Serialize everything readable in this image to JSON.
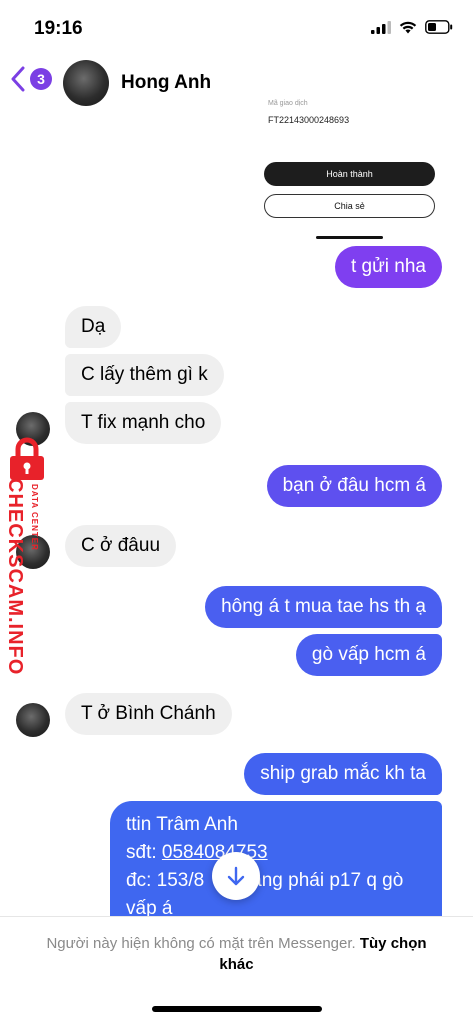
{
  "status": {
    "time": "19:16"
  },
  "header": {
    "back_count": "3",
    "contact_name": "Hong Anh"
  },
  "receipt": {
    "small_text": "Mã giao dịch",
    "code": "FT22143000248693",
    "primary_button": "Hoàn thành",
    "secondary_button": "Chia sẻ"
  },
  "messages": [
    {
      "side": "out",
      "text": "t gửi nha"
    },
    {
      "side": "in",
      "text": "Dạ"
    },
    {
      "side": "in",
      "text": "C lấy thêm gì k"
    },
    {
      "side": "in",
      "text": "T fix mạnh cho"
    },
    {
      "side": "out",
      "text": "bạn ở đâu hcm á"
    },
    {
      "side": "in",
      "text": "C ở đâuu"
    },
    {
      "side": "out",
      "text": "hông á t mua tae hs th ạ"
    },
    {
      "side": "out",
      "text": "gò vấp hcm á"
    },
    {
      "side": "in",
      "text": "T ở Bình Chánh"
    },
    {
      "side": "out",
      "text": "ship grab mắc kh ta"
    },
    {
      "side": "out",
      "line1": "ttin Trâm Anh",
      "line2_prefix": "sđt: ",
      "phone": "0584084753",
      "line3": "đc: 153/8",
      "line3_rest": "àng phái p17 q gò",
      "line4": "vấp á"
    }
  ],
  "watermark": {
    "main": "CHECKSCAM.INFO",
    "sub": "DATA CENTER"
  },
  "footer": {
    "notice": "Người này hiện không có mặt trên Messenger.",
    "link": "Tùy chọn khác"
  },
  "colors": {
    "outgoing_top": "#8a3de8",
    "outgoing_bottom": "#3f6af0",
    "incoming": "#efefef",
    "badge": "#7b3fe4",
    "watermark": "#e8222a"
  },
  "icons": [
    "signal-icon",
    "wifi-icon",
    "battery-icon",
    "back-chevron-icon",
    "arrow-down-icon",
    "lock-icon"
  ]
}
